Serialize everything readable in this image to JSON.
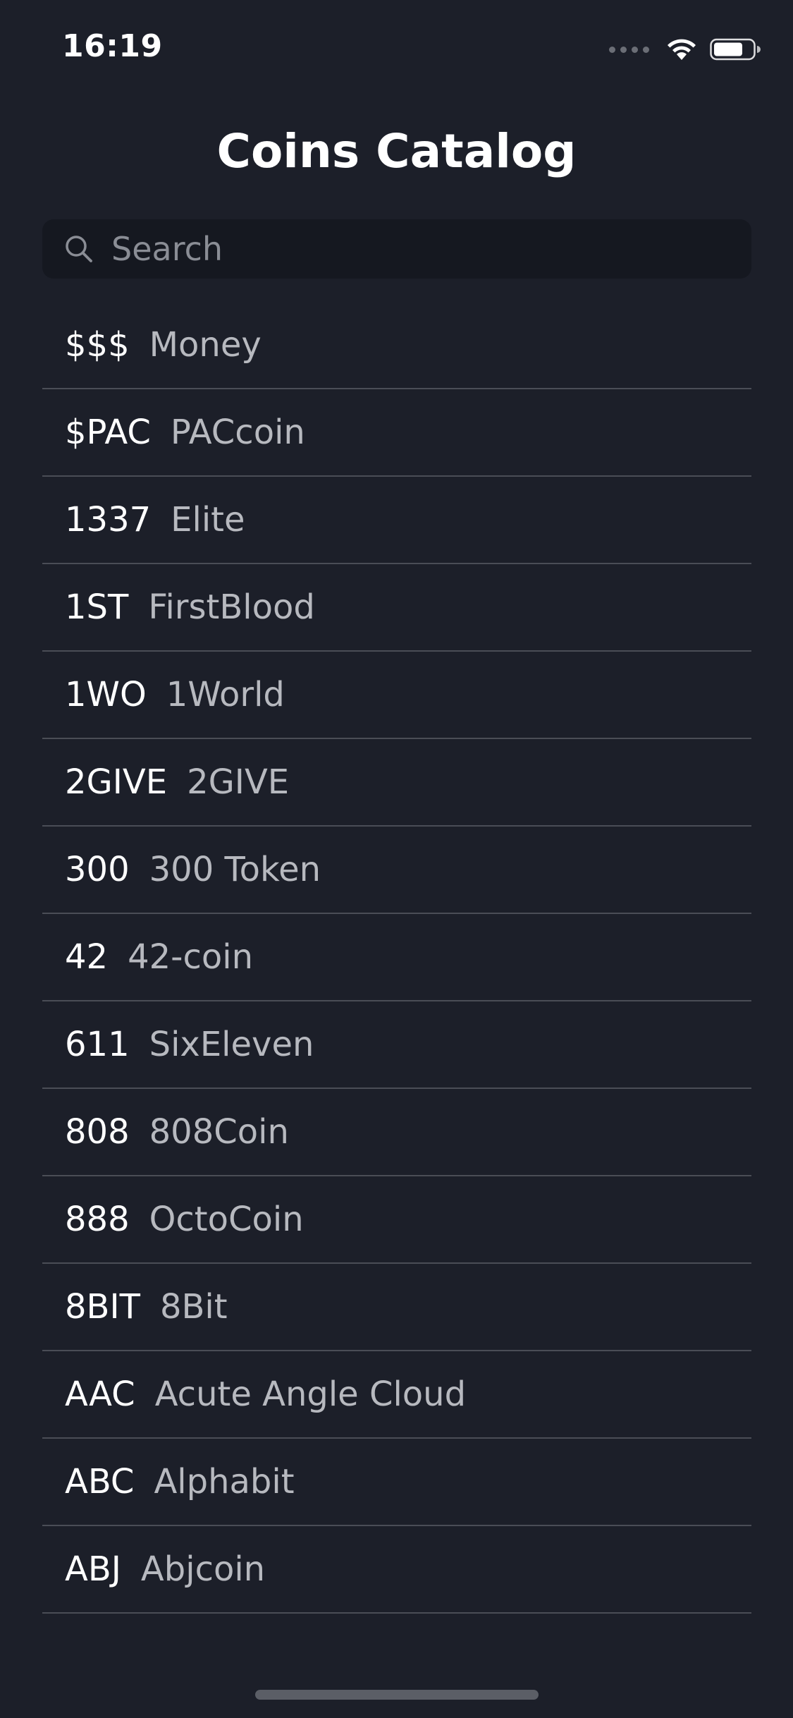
{
  "status_bar": {
    "time": "16:19"
  },
  "nav": {
    "title": "Coins Catalog"
  },
  "search": {
    "placeholder": "Search",
    "value": ""
  },
  "coins": [
    {
      "symbol": "$$$",
      "name": "Money"
    },
    {
      "symbol": "$PAC",
      "name": "PACcoin"
    },
    {
      "symbol": "1337",
      "name": "Elite"
    },
    {
      "symbol": "1ST",
      "name": "FirstBlood"
    },
    {
      "symbol": "1WO",
      "name": "1World"
    },
    {
      "symbol": "2GIVE",
      "name": "2GIVE"
    },
    {
      "symbol": "300",
      "name": "300 Token"
    },
    {
      "symbol": "42",
      "name": "42-coin"
    },
    {
      "symbol": "611",
      "name": "SixEleven"
    },
    {
      "symbol": "808",
      "name": "808Coin"
    },
    {
      "symbol": "888",
      "name": "OctoCoin"
    },
    {
      "symbol": "8BIT",
      "name": "8Bit"
    },
    {
      "symbol": "AAC",
      "name": "Acute Angle Cloud"
    },
    {
      "symbol": "ABC",
      "name": "Alphabit"
    },
    {
      "symbol": "ABJ",
      "name": "Abjcoin"
    }
  ],
  "icons": {
    "search": "search-icon",
    "wifi": "wifi-icon",
    "battery": "battery-icon",
    "signal": "cellular-signal-icon"
  },
  "colors": {
    "background": "#1c1f29",
    "search_background": "#151820",
    "separator": "#4a4d56",
    "symbol_text": "#ffffff",
    "name_text": "#b7b9bf"
  }
}
